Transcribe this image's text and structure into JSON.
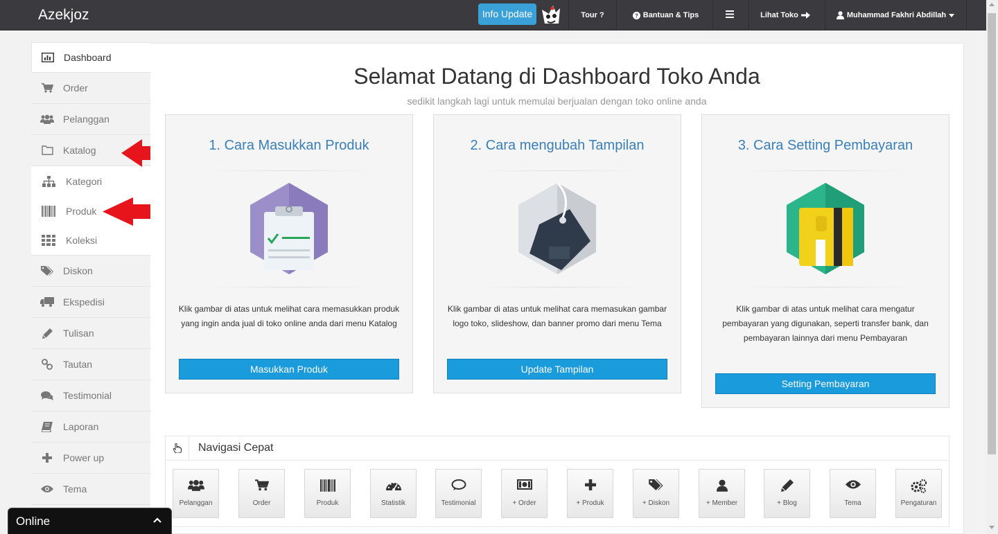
{
  "header": {
    "brand": "Azekjoz",
    "info_update": "Info Update",
    "tour": "Tour ?",
    "help": "Bantuan & Tips",
    "view_store": "Lihat Toko",
    "user": "Muhammad Fakhri Abdillah"
  },
  "sidebar": {
    "items": [
      {
        "label": "Dashboard",
        "icon": "bar-chart-icon"
      },
      {
        "label": "Order",
        "icon": "cart-icon"
      },
      {
        "label": "Pelanggan",
        "icon": "users-icon"
      },
      {
        "label": "Katalog",
        "icon": "folder-icon"
      },
      {
        "label": "Kategori",
        "icon": "sitemap-icon"
      },
      {
        "label": "Produk",
        "icon": "barcode-icon"
      },
      {
        "label": "Koleksi",
        "icon": "grid-icon"
      },
      {
        "label": "Diskon",
        "icon": "tags-icon"
      },
      {
        "label": "Ekspedisi",
        "icon": "truck-icon"
      },
      {
        "label": "Tulisan",
        "icon": "pencil-icon"
      },
      {
        "label": "Tautan",
        "icon": "link-icon"
      },
      {
        "label": "Testimonial",
        "icon": "comments-icon"
      },
      {
        "label": "Laporan",
        "icon": "book-icon"
      },
      {
        "label": "Power up",
        "icon": "plus-icon"
      },
      {
        "label": "Tema",
        "icon": "eye-icon"
      }
    ]
  },
  "main": {
    "title": "Selamat Datang di Dashboard Toko Anda",
    "subtitle": "sedikit langkah lagi untuk memulai berjualan dengan toko online anda",
    "cards": [
      {
        "title": "1. Cara Masukkan Produk",
        "desc": "Klik gambar di atas untuk melihat cara memasukkan produk yang ingin anda jual di toko online anda dari menu Katalog",
        "button": "Masukkan Produk"
      },
      {
        "title": "2. Cara mengubah Tampilan",
        "desc": "Klik gambar di atas untuk melihat cara memasukan gambar logo toko, slideshow, dan banner promo dari menu Tema",
        "button": "Update Tampilan"
      },
      {
        "title": "3. Cara Setting Pembayaran",
        "desc": "Klik gambar di atas untuk melihat cara mengatur pembayaran yang digunakan, seperti transfer bank, dan pembayaran lainnya dari menu Pembayaran",
        "button": "Setting Pembayaran"
      }
    ]
  },
  "quick_nav": {
    "title": "Navigasi Cepat",
    "tiles": [
      {
        "label": "Pelanggan",
        "icon": "users-icon"
      },
      {
        "label": "Order",
        "icon": "cart-icon"
      },
      {
        "label": "Produk",
        "icon": "barcode-icon"
      },
      {
        "label": "Statistik",
        "icon": "dashboard-icon"
      },
      {
        "label": "Testimonial",
        "icon": "comment-icon"
      },
      {
        "label": "+ Order",
        "icon": "money-icon"
      },
      {
        "label": "+ Produk",
        "icon": "plus-icon"
      },
      {
        "label": "+ Diskon",
        "icon": "tags-icon"
      },
      {
        "label": "+ Member",
        "icon": "user-icon"
      },
      {
        "label": "+ Blog",
        "icon": "pencil-icon"
      },
      {
        "label": "Tema",
        "icon": "eye-icon"
      },
      {
        "label": "Pengaturan",
        "icon": "cogs-icon"
      }
    ]
  },
  "chat": {
    "label": "Online"
  },
  "colors": {
    "accent": "#1a9bdc",
    "title_blue": "#3a7fb8",
    "topbar": "#3b3a3f",
    "arrow": "#e8141c"
  }
}
